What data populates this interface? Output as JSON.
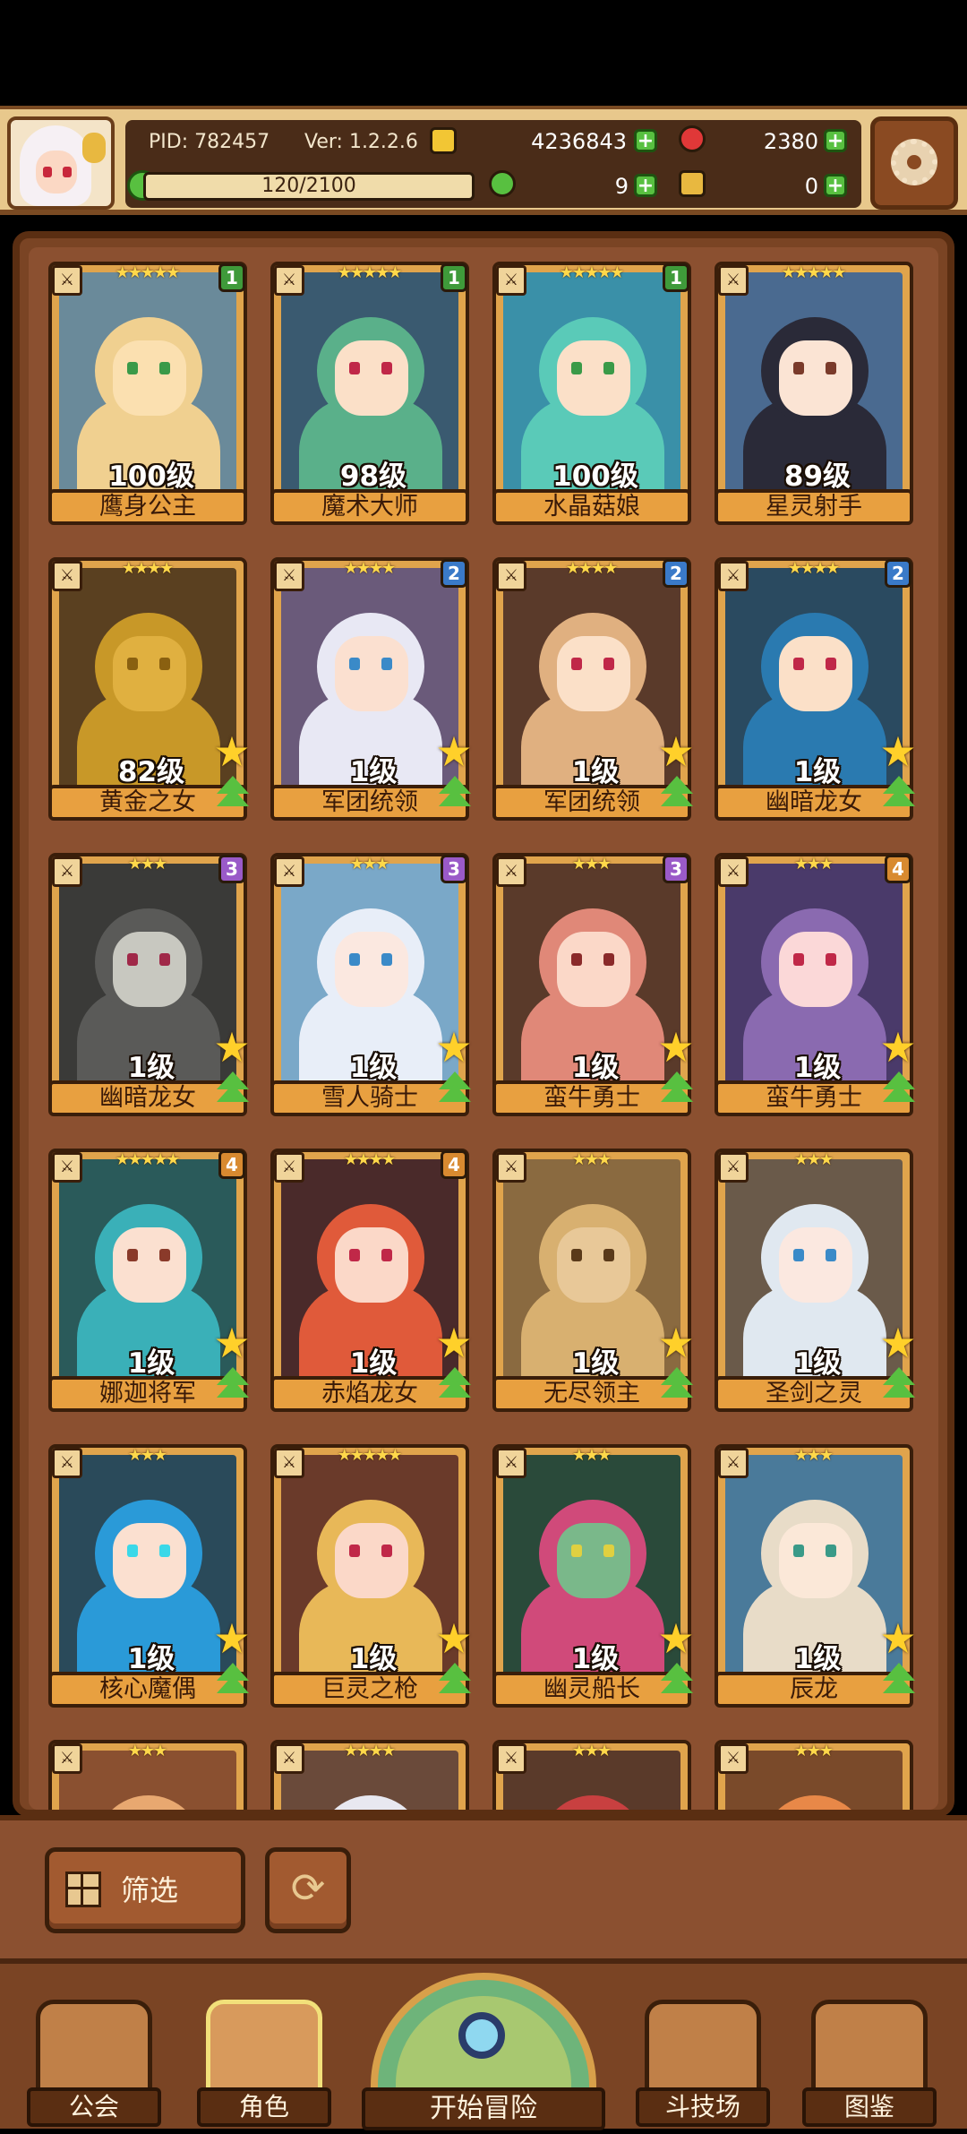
{
  "header": {
    "pid_label": "PID: 782457",
    "version_label": "Ver: 1.2.2.6",
    "gold": "4236843",
    "gems": "2380",
    "stamina": "120/2100",
    "clover": "9",
    "keys": "0",
    "colors": {
      "gold": "#f2c634",
      "gem": "#e03838",
      "clover": "#58c040",
      "key": "#e8b840"
    }
  },
  "roster": {
    "cards": [
      {
        "name": "鹰身公主",
        "level": "100级",
        "stars": "★★★★★",
        "badge": "1",
        "badge_color": "#3f9a3a",
        "skin": "#fbe0b0",
        "hair": "#f0d090",
        "bg": "#6a8a9a",
        "eye": "#3a9a48",
        "star_up": false
      },
      {
        "name": "魔术大师",
        "level": "98级",
        "stars": "★★★★★",
        "badge": "1",
        "badge_color": "#3f9a3a",
        "skin": "#fbe0c8",
        "hair": "#5ab08a",
        "bg": "#3a5a70",
        "eye": "#c02848",
        "star_up": false
      },
      {
        "name": "水晶菇娘",
        "level": "100级",
        "stars": "★★★★★",
        "badge": "1",
        "badge_color": "#3f9a3a",
        "skin": "#fbe0c8",
        "hair": "#5acab8",
        "bg": "#3a90a8",
        "eye": "#3a9a48",
        "star_up": false
      },
      {
        "name": "星灵射手",
        "level": "89级",
        "stars": "★★★★★",
        "badge": "",
        "badge_color": "",
        "skin": "#fbe4d4",
        "hair": "#2a2a38",
        "bg": "#4a6a90",
        "eye": "#7a3a2a",
        "star_up": false
      },
      {
        "name": "黄金之女",
        "level": "82级",
        "stars": "★★★★",
        "badge": "",
        "badge_color": "",
        "skin": "#e0b040",
        "hair": "#c89828",
        "bg": "#5a4020",
        "eye": "#8a6010",
        "star_up": true
      },
      {
        "name": "军团统领",
        "level": "1级",
        "stars": "★★★★",
        "badge": "2",
        "badge_color": "#3a7ac8",
        "skin": "#fbe0d0",
        "hair": "#e8e8f4",
        "bg": "#6a5a7a",
        "eye": "#3a8ac8",
        "star_up": true
      },
      {
        "name": "军团统领",
        "level": "1级",
        "stars": "★★★★",
        "badge": "2",
        "badge_color": "#3a7ac8",
        "skin": "#fbe0c8",
        "hair": "#e0b080",
        "bg": "#5a3a2a",
        "eye": "#c02848",
        "star_up": true
      },
      {
        "name": "幽暗龙女",
        "level": "1级",
        "stars": "★★★★",
        "badge": "2",
        "badge_color": "#3a7ac8",
        "skin": "#fbe0c8",
        "hair": "#2a7ab0",
        "bg": "#2a4a60",
        "eye": "#c02848",
        "star_up": true
      },
      {
        "name": "幽暗龙女",
        "level": "1级",
        "stars": "★★★",
        "badge": "3",
        "badge_color": "#9a5ac8",
        "skin": "#c8c8c0",
        "hair": "#5a5a58",
        "bg": "#3a3a38",
        "eye": "#a02848",
        "star_up": true
      },
      {
        "name": "雪人骑士",
        "level": "1级",
        "stars": "★★★",
        "badge": "3",
        "badge_color": "#9a5ac8",
        "skin": "#fbe8e0",
        "hair": "#e8eef8",
        "bg": "#7aa8c8",
        "eye": "#3a8ac8",
        "star_up": true
      },
      {
        "name": "蛮牛勇士",
        "level": "1级",
        "stars": "★★★",
        "badge": "3",
        "badge_color": "#9a5ac8",
        "skin": "#fbd8c8",
        "hair": "#e08878",
        "bg": "#5a3a2a",
        "eye": "#8a2a2a",
        "star_up": true
      },
      {
        "name": "蛮牛勇士",
        "level": "1级",
        "stars": "★★★",
        "badge": "4",
        "badge_color": "#d88a30",
        "skin": "#fbd8d8",
        "hair": "#8a6ab0",
        "bg": "#4a3a6a",
        "eye": "#c02848",
        "star_up": true
      },
      {
        "name": "娜迦将军",
        "level": "1级",
        "stars": "★★★★★",
        "badge": "4",
        "badge_color": "#d88a30",
        "skin": "#fbe0d0",
        "hair": "#3ab0b8",
        "bg": "#2a5a5a",
        "eye": "#8a3a2a",
        "star_up": true
      },
      {
        "name": "赤焰龙女",
        "level": "1级",
        "stars": "★★★★",
        "badge": "4",
        "badge_color": "#d88a30",
        "skin": "#fbd8c8",
        "hair": "#e05a3a",
        "bg": "#4a2a2a",
        "eye": "#c02848",
        "star_up": true
      },
      {
        "name": "无尽领主",
        "level": "1级",
        "stars": "★★★",
        "badge": "",
        "badge_color": "",
        "skin": "#e8c898",
        "hair": "#d8b070",
        "bg": "#8a6a40",
        "eye": "#5a3a1a",
        "star_up": true
      },
      {
        "name": "圣剑之灵",
        "level": "1级",
        "stars": "★★★",
        "badge": "",
        "badge_color": "",
        "skin": "#fbe8e0",
        "hair": "#e0e8f0",
        "bg": "#6a5a4a",
        "eye": "#3a8ac8",
        "star_up": true
      },
      {
        "name": "核心魔偶",
        "level": "1级",
        "stars": "★★★",
        "badge": "",
        "badge_color": "",
        "skin": "#fbe0d0",
        "hair": "#2a9ad8",
        "bg": "#2a4a5a",
        "eye": "#3ad8e8",
        "star_up": true
      },
      {
        "name": "巨灵之枪",
        "level": "1级",
        "stars": "★★★★★",
        "badge": "",
        "badge_color": "",
        "skin": "#fbd8c8",
        "hair": "#e8b858",
        "bg": "#6a3a2a",
        "eye": "#c02848",
        "star_up": true
      },
      {
        "name": "幽灵船长",
        "level": "1级",
        "stars": "★★★",
        "badge": "",
        "badge_color": "",
        "skin": "#7ab88a",
        "hair": "#d04a7a",
        "bg": "#2a4a3a",
        "eye": "#e0d040",
        "star_up": true
      },
      {
        "name": "辰龙",
        "level": "1级",
        "stars": "★★★",
        "badge": "",
        "badge_color": "",
        "skin": "#fbe8d8",
        "hair": "#e8dcc8",
        "bg": "#4a7a9a",
        "eye": "#3a9a88",
        "star_up": true
      },
      {
        "name": "",
        "level": "",
        "stars": "★★★",
        "badge": "",
        "badge_color": "",
        "skin": "#fbe0c8",
        "hair": "#e8a870",
        "bg": "#8a5030",
        "eye": "#8a3a2a",
        "star_up": false
      },
      {
        "name": "",
        "level": "",
        "stars": "★★★★",
        "badge": "",
        "badge_color": "",
        "skin": "#fbe8e0",
        "hair": "#e8e8f0",
        "bg": "#6a4a3a",
        "eye": "#8a3a2a",
        "star_up": false
      },
      {
        "name": "",
        "level": "",
        "stars": "★★★",
        "badge": "",
        "badge_color": "",
        "skin": "#e8b858",
        "hair": "#c84040",
        "bg": "#5a3a2a",
        "eye": "#8a3a2a",
        "star_up": false
      },
      {
        "name": "",
        "level": "",
        "stars": "★★★",
        "badge": "",
        "badge_color": "",
        "skin": "#fbd8c0",
        "hair": "#e88848",
        "bg": "#7a4a2a",
        "eye": "#8a3a2a",
        "star_up": false
      }
    ]
  },
  "controls": {
    "filter_label": "筛选",
    "refresh_icon": "refresh-icon"
  },
  "nav": {
    "guild": "公会",
    "character": "角色",
    "adventure": "开始冒险",
    "arena": "斗技场",
    "codex": "图鉴"
  }
}
